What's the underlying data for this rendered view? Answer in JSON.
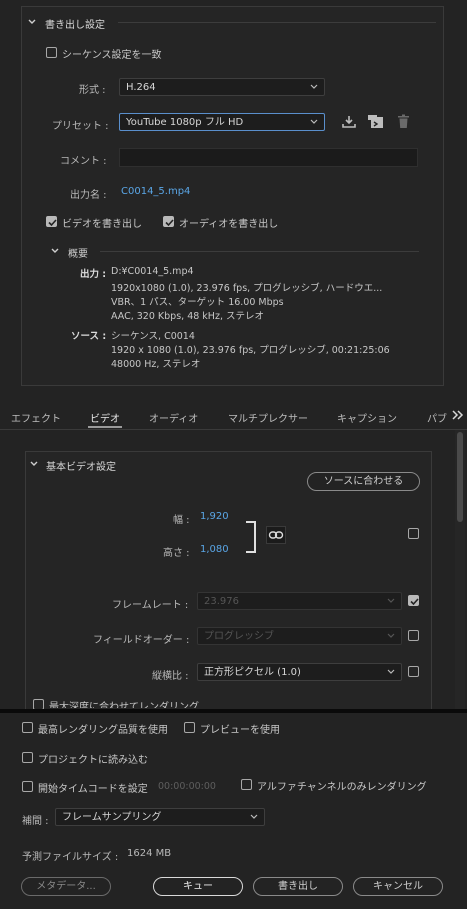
{
  "export_settings": {
    "title": "書き出し設定",
    "match_sequence": "シーケンス設定を一致",
    "format_label": "形式 :",
    "format_value": "H.264",
    "preset_label": "プリセット :",
    "preset_value": "YouTube  1080p フル HD",
    "comment_label": "コメント :",
    "comment_value": "",
    "output_label": "出力名 :",
    "output_value": "C0014_5.mp4",
    "export_video": "ビデオを書き出し",
    "export_audio": "オーディオを書き出し"
  },
  "summary": {
    "title": "概要",
    "output_label": "出力 :",
    "output_lines": [
      "D:¥C0014_5.mp4",
      "1920x1080 (1.0),  23.976 fps, プログレッシブ, ハードウエ...",
      "VBR、1 パス、ターゲット 16.00 Mbps",
      "AAC, 320 Kbps, 48 kHz, ステレオ"
    ],
    "source_label": "ソース :",
    "source_lines": [
      "シーケンス,  C0014",
      "1920 x 1080 (1.0), 23.976 fps, プログレッシブ, 00:21:25:06",
      "48000  Hz, ステレオ"
    ]
  },
  "tabs": [
    "エフェクト",
    "ビデオ",
    "オーディオ",
    "マルチプレクサー",
    "キャプション",
    "パブ"
  ],
  "video": {
    "section_title": "基本ビデオ設定",
    "match_source": "ソースに合わせる",
    "width_label": "幅 :",
    "width_value": "1,920",
    "height_label": "高さ :",
    "height_value": "1,080",
    "frame_rate_label": "フレームレート :",
    "frame_rate_value": "23.976",
    "field_order_label": "フィールドオーダー :",
    "field_order_value": "プログレッシブ",
    "aspect_label": "縦横比 :",
    "aspect_value": "正方形ピクセル (1.0)",
    "max_depth": "最大深度に合わせてレンダリング"
  },
  "bottom": {
    "max_render_quality": "最高レンダリング品質を使用",
    "use_preview": "プレビューを使用",
    "import_project": "プロジェクトに読み込む",
    "set_start_timecode": "開始タイムコードを設定",
    "timecode_value": "00:00:00:00",
    "alpha_only": "アルファチャンネルのみレンダリング",
    "interp_label": "補間 :",
    "interp_value": "フレームサンプリング",
    "est_size_label": "予測ファイルサイズ :",
    "est_size_value": "1624 MB",
    "btn_metadata": "メタデータ...",
    "btn_queue": "キュー",
    "btn_export": "書き出し",
    "btn_cancel": "キャンセル"
  }
}
